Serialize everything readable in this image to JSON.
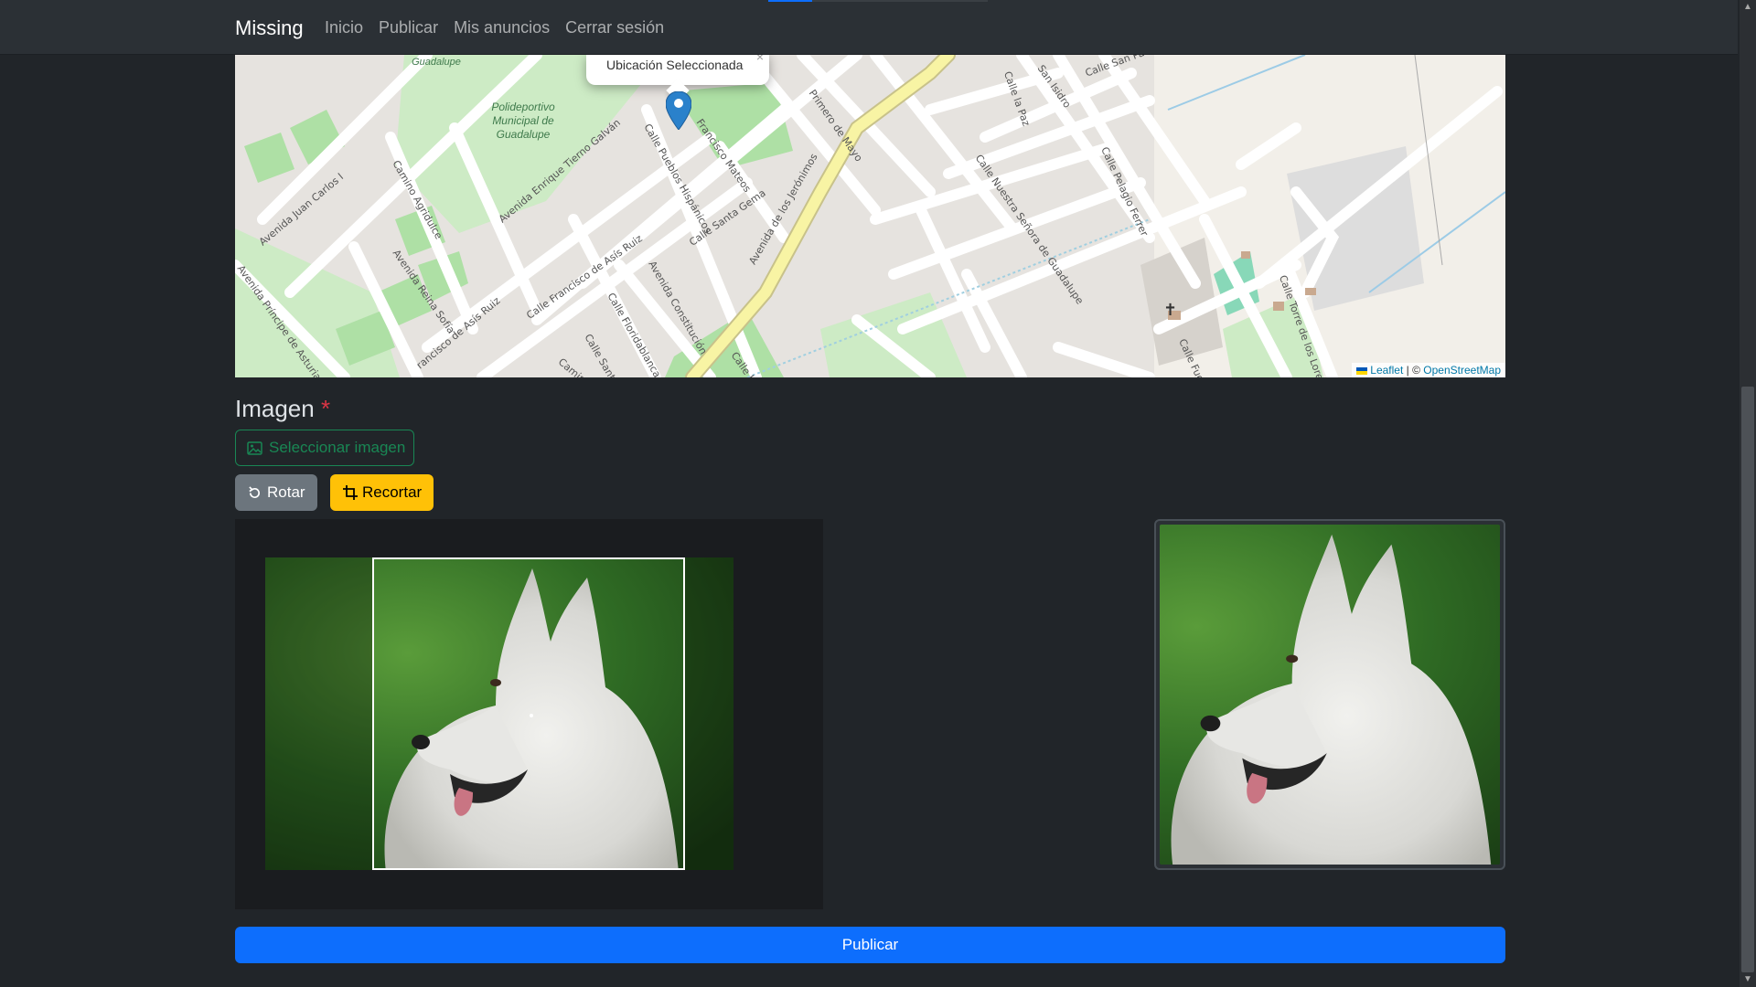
{
  "navbar": {
    "brand": "Missing",
    "links": [
      "Inicio",
      "Publicar",
      "Mis anuncios",
      "Cerrar sesión"
    ]
  },
  "map": {
    "popup_text": "Ubicación Seleccionada",
    "popup_close": "×",
    "park_label": "Polideportivo Municipal de Guadalupe",
    "park_label_top": "Virgen de Guadalupe",
    "streets": [
      "Avenida Juan Carlos I",
      "Camino Agridulce",
      "Avenida Enrique Tierno Galván",
      "Calle Pueblos Hispánicos",
      "Francisco Mateos",
      "Primero de Mayo",
      "Calle la Paz",
      "San Isidro",
      "Calle San Pa",
      "Calle Nuestra Señora de Guadalupe",
      "Calle Pelagio Ferrer",
      "Avenida de los Jerónimos",
      "Calle Santa Gema",
      "Avenida Constitución",
      "Calle Floridablanca",
      "Calle Francisco de Asís Ruiz",
      "Avenida Reina Sofía",
      "Avenida Príncipe de Asturias",
      "Calle Santa Cecilia",
      "Calle Torre de los Lorentes",
      "Calle Fuen",
      "Calle Huer",
      "Camino",
      "rancisco de Asís Ruiz"
    ],
    "attribution_leaflet": "Leaflet",
    "attribution_sep": " | © ",
    "attribution_osm": "OpenStreetMap"
  },
  "form": {
    "image_title": "Imagen",
    "required_mark": "*",
    "select_image_label": "Seleccionar imagen",
    "rotate_label": "Rotar",
    "crop_label": "Recortar",
    "publish_label": "Publicar"
  },
  "colors": {
    "primary": "#0d6efd",
    "success": "#198754",
    "warning": "#ffc107",
    "secondary": "#6c757d",
    "danger": "#dc3545",
    "background": "#212529"
  }
}
